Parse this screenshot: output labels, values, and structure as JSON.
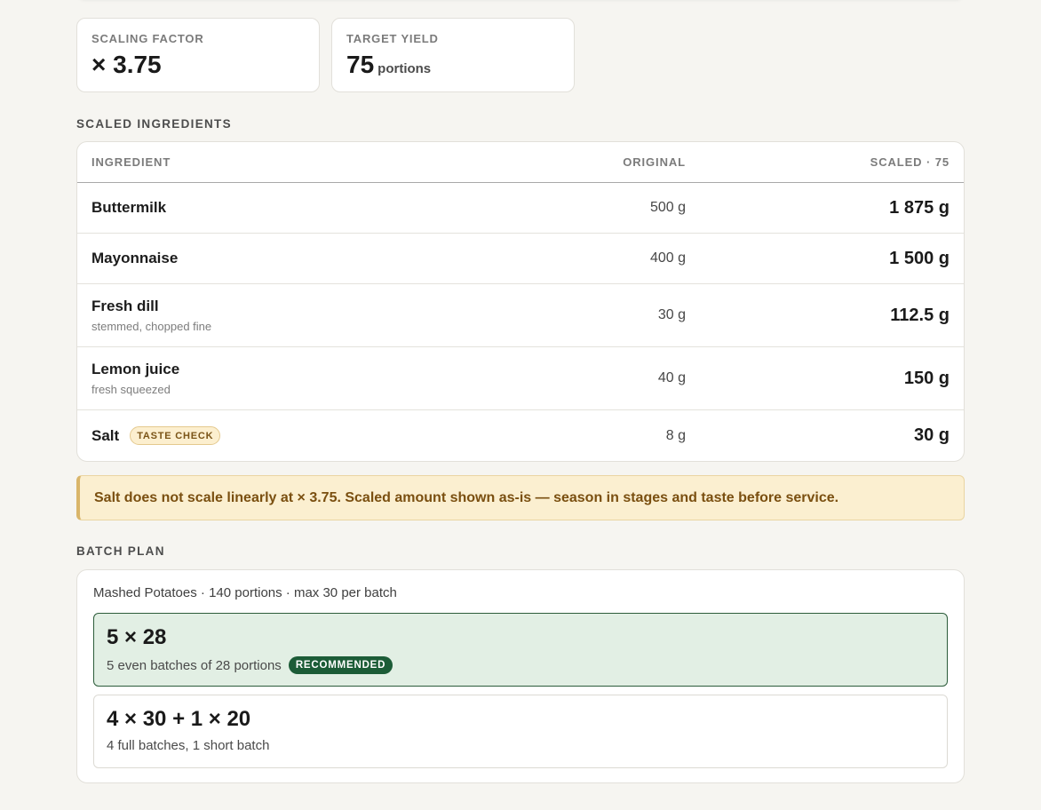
{
  "stats": {
    "scaling_factor_label": "SCALING FACTOR",
    "scaling_factor_value": "× 3.75",
    "target_yield_label": "TARGET YIELD",
    "target_yield_value": "75",
    "target_yield_unit": "portions"
  },
  "ingredients": {
    "section_title": "SCALED INGREDIENTS",
    "columns": {
      "ingredient": "INGREDIENT",
      "original": "ORIGINAL",
      "scaled": "SCALED · 75"
    },
    "rows": [
      {
        "name": "Buttermilk",
        "note": "",
        "original": "500 g",
        "scaled": "1 875 g"
      },
      {
        "name": "Mayonnaise",
        "note": "",
        "original": "400 g",
        "scaled": "1 500 g"
      },
      {
        "name": "Fresh dill",
        "note": "stemmed, chopped fine",
        "original": "30 g",
        "scaled": "112.5 g"
      },
      {
        "name": "Lemon juice",
        "note": "fresh squeezed",
        "original": "40 g",
        "scaled": "150 g"
      },
      {
        "name": "Salt",
        "badge": "TASTE CHECK",
        "note": "",
        "original": "8 g",
        "scaled": "30 g"
      }
    ]
  },
  "warning": {
    "text": "Salt does not scale linearly at × 3.75. Scaled amount shown as-is — season in stages and taste before service."
  },
  "batch_plan": {
    "section_title": "BATCH PLAN",
    "meta": "Mashed Potatoes · 140 portions · max 30 per batch",
    "options": [
      {
        "title": "5 × 28",
        "description": "5 even batches of 28 portions",
        "badge": "RECOMMENDED"
      },
      {
        "title": "4 × 30 + 1 × 20",
        "description": "4 full batches, 1 short batch"
      }
    ]
  }
}
